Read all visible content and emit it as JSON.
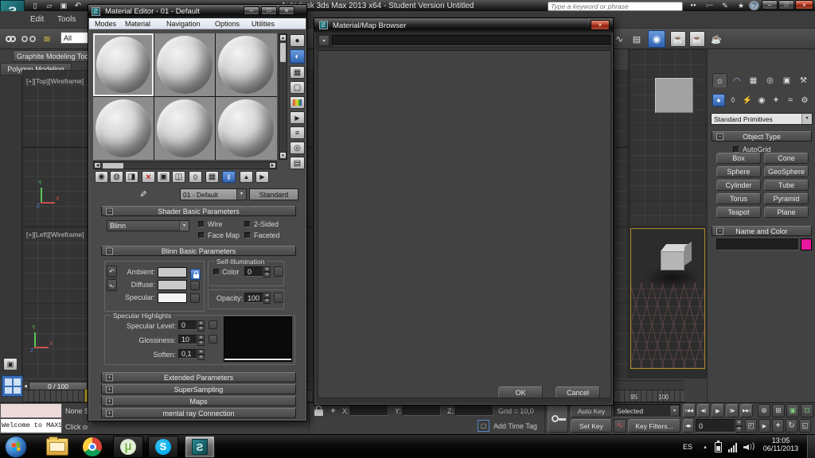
{
  "icons": {
    "min": "–",
    "max": "□",
    "close": "×",
    "dd": "▼",
    "up": "▲",
    "down": "▼",
    "left": "◀",
    "right": "▶",
    "su": "▴",
    "sd": "▾",
    "plus": "+",
    "minus": "−",
    "page": "▯",
    "folder": "▱",
    "disk": "▣",
    "undo": "↶",
    "binoc": "●●",
    "keyi": "○─",
    "pen": "✎",
    "star": "★",
    "help": "?",
    "waves": "≋",
    "curve": "∿",
    "schem": "▤",
    "lens": "◉",
    "teapot": "☕",
    "sphere": "●",
    "half": "◐",
    "checker": "▦",
    "tile": "▢",
    "play": "▶",
    "lines": "≡",
    "target": "◎",
    "nav": "▤",
    "put": "◍",
    "assign": "◨",
    "copy": "▣",
    "lib": "◫",
    "zero": "0",
    "bars": "‖",
    "sun": "☼",
    "arc": "◠",
    "grid": "▦",
    "wheel": "◎",
    "mon": "▣",
    "hammer": "⚒",
    "diamond": "◊",
    "bolt": "⚡",
    "approx": "≈",
    "gear": "⚙",
    "t_start": "|◀◀",
    "t_prev": "◀||",
    "t_play": "▶",
    "t_next": "||▶",
    "t_end": "▶▶|",
    "t_key": "◀▶",
    "z1": "⊕",
    "z2": "⊞",
    "z3": "⊡",
    "z4": "◰",
    "orbit": "↻",
    "maxi": "◱",
    "mu": "µ",
    "s": "S",
    "logo": "Ƨ"
  },
  "app": {
    "title": "Autodesk 3ds Max  2013 x64  - Student Version   Untitled",
    "menus": [
      "Edit",
      "Tools"
    ],
    "selection_filter_label": "All",
    "search_placeholder": "Type a keyword or phrase",
    "ribbon_tabs": [
      "Graphite Modeling Tools",
      "Polygon Modeling"
    ],
    "viewport_top_label": "[+][Top][Wireframe]",
    "viewport_left_label": "[+][Left][Wireframe]"
  },
  "material_editor": {
    "title": "Material Editor - 01 - Default",
    "menus": [
      "Modes",
      "Material",
      "Navigation",
      "Options",
      "Utilities"
    ],
    "material_name": "01 - Default",
    "type_button_label": "Standard",
    "shader_params": {
      "title": "Shader Basic Parameters",
      "shader_type": "Blinn",
      "wire": "Wire",
      "two_sided": "2-Sided",
      "face_map": "Face Map",
      "faceted": "Faceted"
    },
    "blinn_params": {
      "title": "Blinn Basic Parameters",
      "ambient": "Ambient:",
      "diffuse": "Diffuse:",
      "specular": "Specular:",
      "self_illum_title": "Self-Illumination",
      "color_label": "Color",
      "self_illum_value": "0",
      "opacity_label": "Opacity:",
      "opacity_value": "100"
    },
    "specular_highlights": {
      "title": "Specular Highlights",
      "specular_level_label": "Specular Level:",
      "specular_level_value": "0",
      "glossiness_label": "Glossiness:",
      "glossiness_value": "10",
      "soften_label": "Soften:",
      "soften_value": "0,1"
    },
    "rollouts": [
      "Extended Parameters",
      "SuperSampling",
      "Maps",
      "mental ray Connection"
    ]
  },
  "browser": {
    "title": "Material/Map Browser",
    "search_value": "",
    "ok_label": "OK",
    "cancel_label": "Cancel"
  },
  "command_panel": {
    "category_dropdown": "Standard Primitives",
    "object_type_title": "Object Type",
    "autogrid_label": "AutoGrid",
    "object_buttons": [
      "Box",
      "Cone",
      "Sphere",
      "GeoSphere",
      "Cylinder",
      "Tube",
      "Torus",
      "Pyramid",
      "Teapot",
      "Plane"
    ],
    "name_color_title": "Name and Color",
    "object_color": "#e8189c"
  },
  "timeline": {
    "slider_label": "0 / 100",
    "tick_labels": [
      "95",
      "100"
    ]
  },
  "status_bar": {
    "listener_text": "Welcome to MAXScript",
    "status_text": "None Selected",
    "prompt_text": "Click or click-and-drag to select objects",
    "x_label": "X:",
    "y_label": "Y:",
    "z_label": "Z:",
    "grid_text": "Grid = 10,0",
    "add_time_tag": "Add Time Tag",
    "auto_key_label": "Auto Key",
    "set_key_label": "Set Key",
    "selection_set_value": "Selected",
    "key_filters_label": "Key Filters...",
    "frame_value": "0"
  },
  "taskbar": {
    "language": "ES",
    "time": "13:05",
    "date": "06/11/2013"
  }
}
